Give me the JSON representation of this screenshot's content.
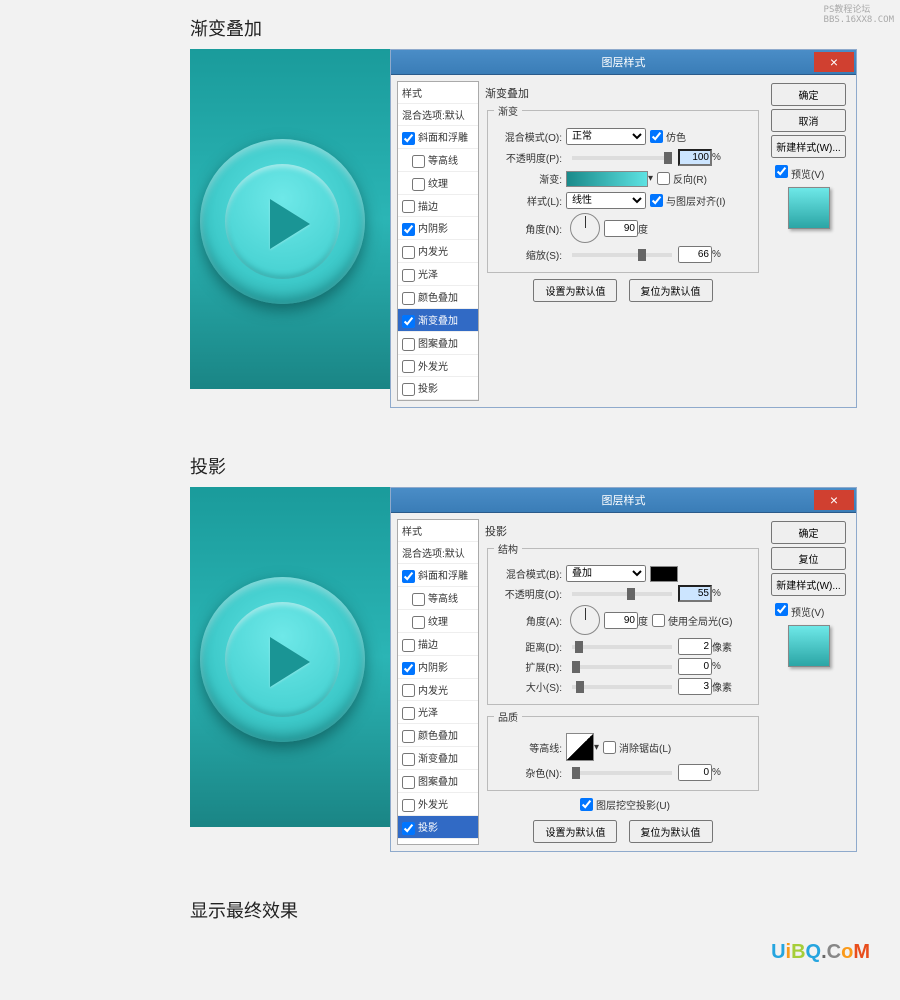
{
  "watermark": {
    "line1": "PS教程论坛",
    "line2": "BBS.16XX8.COM"
  },
  "section1_title": "渐变叠加",
  "section2_title": "投影",
  "section3_title": "显示最终效果",
  "dialog_title": "图层样式",
  "close_glyph": "×",
  "styles": {
    "header": "样式",
    "blending": "混合选项:默认",
    "bevel": "斜面和浮雕",
    "bevel_chk": true,
    "contour": "等高线",
    "contour_chk": false,
    "texture": "纹理",
    "texture_chk": false,
    "stroke": "描边",
    "stroke_chk": false,
    "inner_shadow": "内阴影",
    "inner_shadow_chk": true,
    "inner_glow": "内发光",
    "inner_glow_chk": false,
    "satin": "光泽",
    "satin_chk": false,
    "color_overlay": "颜色叠加",
    "color_overlay_chk": false,
    "grad_overlay": "渐变叠加",
    "grad_overlay_chk": true,
    "pattern": "图案叠加",
    "pattern_chk": false,
    "outer_glow": "外发光",
    "outer_glow_chk": false,
    "drop_shadow": "投影",
    "drop_shadow_chk": false,
    "drop_shadow_chk2": true
  },
  "gradient": {
    "panel_title": "渐变叠加",
    "group_title": "渐变",
    "blend_label": "混合模式(O):",
    "blend_value": "正常",
    "dither_label": "仿色",
    "dither_chk": true,
    "opacity_label": "不透明度(P):",
    "opacity_val": "100",
    "pct": "%",
    "grad_label": "渐变:",
    "reverse_label": "反向(R)",
    "reverse_chk": false,
    "style_label": "样式(L):",
    "style_value": "线性",
    "align_label": "与图层对齐(I)",
    "align_chk": true,
    "angle_label": "角度(N):",
    "angle_val": "90",
    "deg": "度",
    "scale_label": "缩放(S):",
    "scale_val": "66",
    "default_btn": "设置为默认值",
    "reset_btn": "复位为默认值"
  },
  "shadow": {
    "panel_title": "投影",
    "group1": "结构",
    "blend_label": "混合模式(B):",
    "blend_value": "叠加",
    "opacity_label": "不透明度(O):",
    "opacity_val": "55",
    "pct": "%",
    "angle_label": "角度(A):",
    "angle_val": "90",
    "deg": "度",
    "global_label": "使用全局光(G)",
    "global_chk": false,
    "distance_label": "距离(D):",
    "distance_val": "2",
    "px": "像素",
    "spread_label": "扩展(R):",
    "spread_val": "0",
    "size_label": "大小(S):",
    "size_val": "3",
    "group2": "品质",
    "contour_label": "等高线:",
    "anti_label": "消除锯齿(L)",
    "anti_chk": false,
    "noise_label": "杂色(N):",
    "noise_val": "0",
    "knockout_label": "图层挖空投影(U)",
    "knockout_chk": true,
    "default_btn": "设置为默认值",
    "reset_btn": "复位为默认值"
  },
  "side": {
    "ok": "确定",
    "cancel": "取消",
    "cancel2": "复位",
    "new_style": "新建样式(W)...",
    "preview_label": "预览(V)",
    "preview_chk": true
  },
  "uibq": {
    "u": "U",
    "i": "i",
    "b": "B",
    "q": "Q",
    "d": ".",
    "c": "C",
    "o": "o",
    "m": "M"
  }
}
